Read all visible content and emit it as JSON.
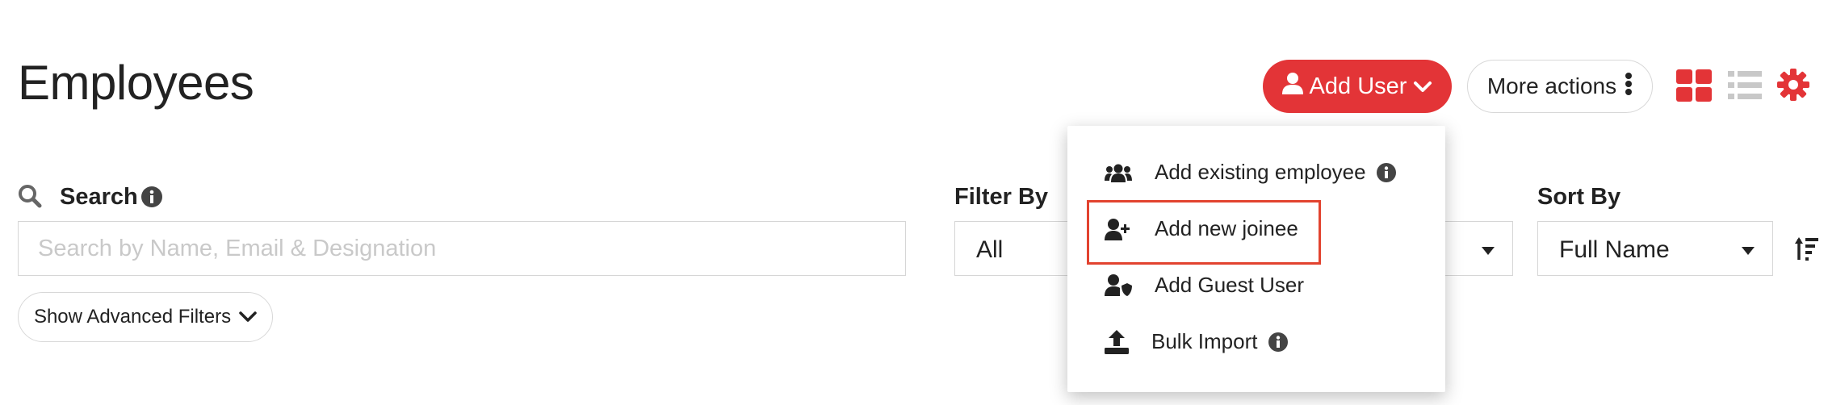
{
  "page": {
    "title": "Employees"
  },
  "header": {
    "add_user_label": "Add User",
    "more_actions_label": "More actions"
  },
  "search": {
    "label": "Search",
    "placeholder": "Search by Name, Email & Designation"
  },
  "advanced_filters": {
    "label": "Show Advanced Filters"
  },
  "filter": {
    "label": "Filter By",
    "value": "All"
  },
  "sort": {
    "label": "Sort By",
    "value": "Full Name"
  },
  "dropdown": {
    "items": [
      {
        "label": "Add existing employee",
        "icon": "users-group-icon",
        "info": true
      },
      {
        "label": "Add new joinee",
        "icon": "user-plus-icon",
        "highlighted": true
      },
      {
        "label": "Add Guest User",
        "icon": "user-shield-icon"
      },
      {
        "label": "Bulk Import",
        "icon": "upload-icon",
        "info": true
      }
    ]
  },
  "colors": {
    "accent": "#e33437",
    "highlight_border": "#e2432f",
    "text": "#222222",
    "placeholder": "#c9c9c9",
    "inactive_icon": "#c8c8c8"
  }
}
